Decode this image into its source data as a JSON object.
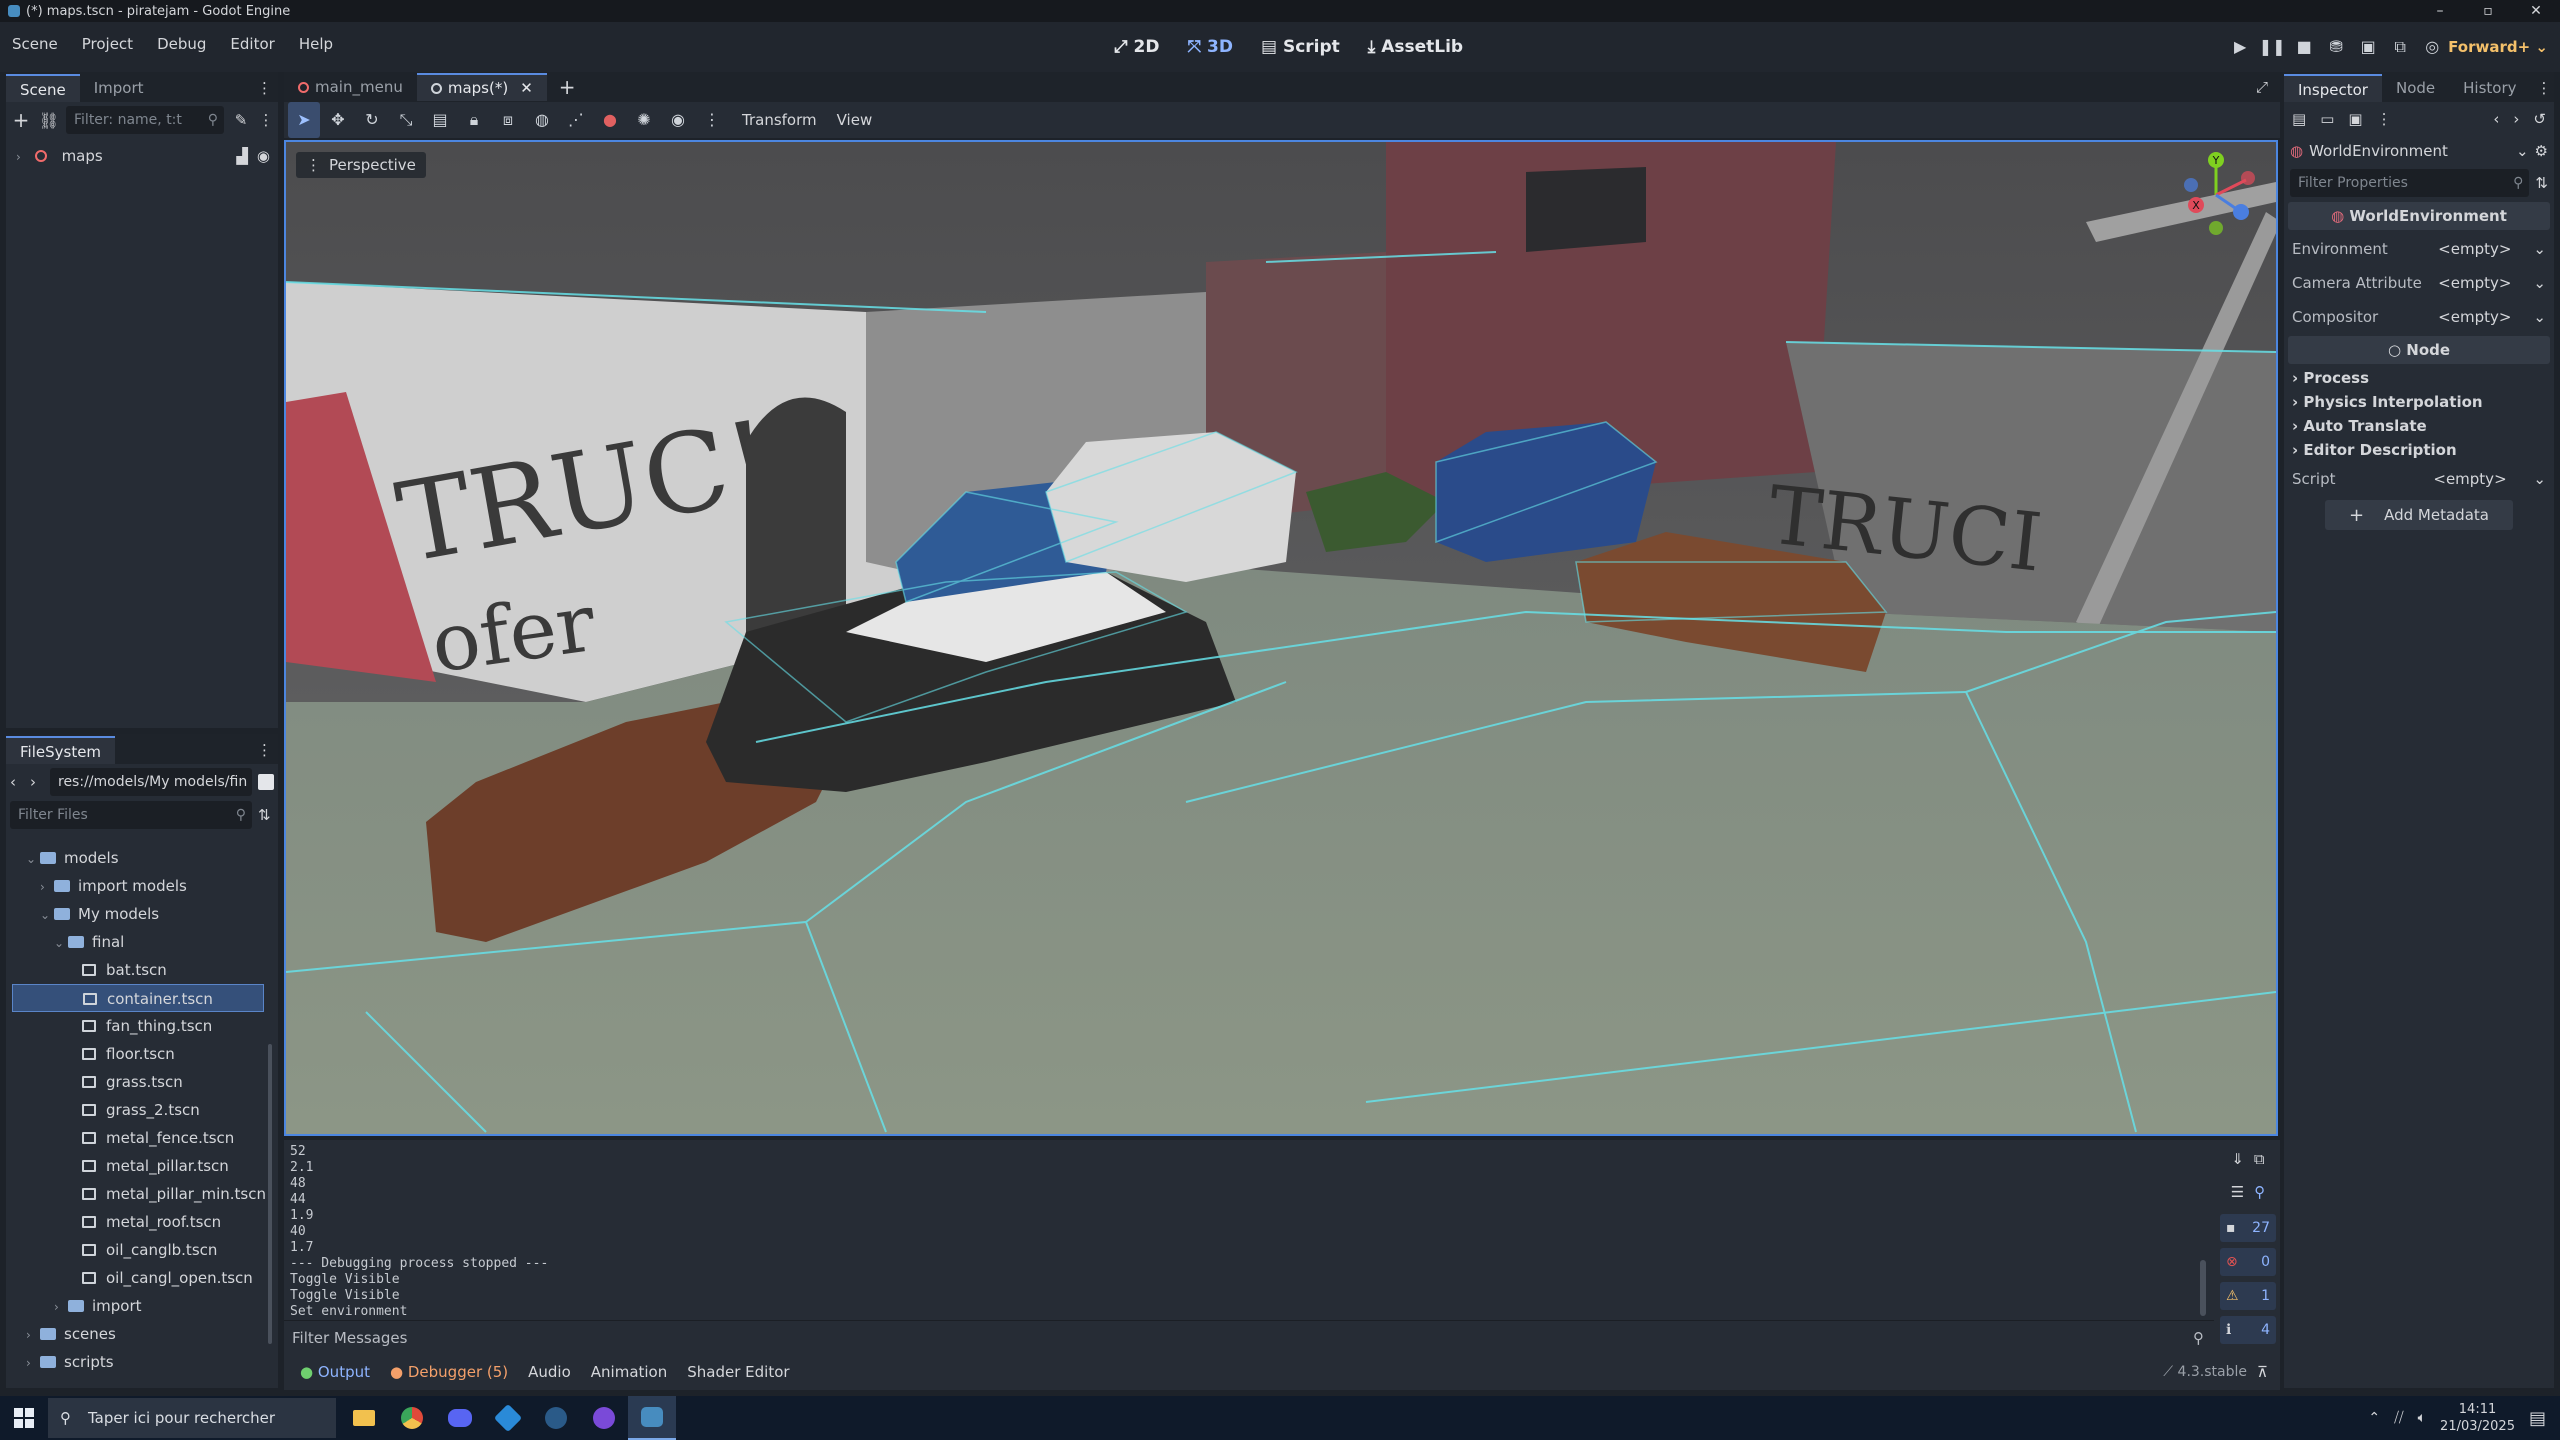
{
  "window": {
    "title": "(*) maps.tscn - piratejam - Godot Engine",
    "controls": [
      "–",
      "▫",
      "✕"
    ]
  },
  "menu": [
    "Scene",
    "Project",
    "Debug",
    "Editor",
    "Help"
  ],
  "modes": {
    "2d": "2D",
    "3d": "3D",
    "script": "Script",
    "assetlib": "AssetLib"
  },
  "renderer": "Forward+",
  "scene_dock": {
    "tabs": [
      "Scene",
      "Import"
    ],
    "filter_placeholder": "Filter: name, t:t",
    "root_node": "maps"
  },
  "filesystem": {
    "tab": "FileSystem",
    "path": "res://models/My models/fin",
    "filter_placeholder": "Filter Files",
    "items": [
      {
        "label": "models",
        "type": "folder",
        "depth": 1,
        "expanded": true
      },
      {
        "label": "import models",
        "type": "folder",
        "depth": 2,
        "expanded": false
      },
      {
        "label": "My models",
        "type": "folder",
        "depth": 2,
        "expanded": true
      },
      {
        "label": "final",
        "type": "folder",
        "depth": 3,
        "expanded": true
      },
      {
        "label": "bat.tscn",
        "type": "scene",
        "depth": 4
      },
      {
        "label": "container.tscn",
        "type": "scene",
        "depth": 4,
        "selected": true
      },
      {
        "label": "fan_thing.tscn",
        "type": "scene",
        "depth": 4
      },
      {
        "label": "floor.tscn",
        "type": "scene",
        "depth": 4
      },
      {
        "label": "grass.tscn",
        "type": "scene",
        "depth": 4
      },
      {
        "label": "grass_2.tscn",
        "type": "scene",
        "depth": 4
      },
      {
        "label": "metal_fence.tscn",
        "type": "scene",
        "depth": 4
      },
      {
        "label": "metal_pillar.tscn",
        "type": "scene",
        "depth": 4
      },
      {
        "label": "metal_pillar_min.tscn",
        "type": "scene",
        "depth": 4
      },
      {
        "label": "metal_roof.tscn",
        "type": "scene",
        "depth": 4
      },
      {
        "label": "oil_canglb.tscn",
        "type": "scene",
        "depth": 4
      },
      {
        "label": "oil_cangl_open.tscn",
        "type": "scene",
        "depth": 4
      },
      {
        "label": "import",
        "type": "folder",
        "depth": 3,
        "expanded": false
      },
      {
        "label": "scenes",
        "type": "folder",
        "depth": 1,
        "expanded": false
      },
      {
        "label": "scripts",
        "type": "folder",
        "depth": 1,
        "expanded": false
      }
    ]
  },
  "editor_tabs": [
    {
      "label": "main_menu",
      "active": false
    },
    {
      "label": "maps(*)",
      "active": true
    }
  ],
  "viewport_toolbar": {
    "transform": "Transform",
    "view": "View"
  },
  "viewport": {
    "perspective_label": "Perspective"
  },
  "output": {
    "log_lines": [
      "52",
      "2.1",
      "48",
      "44",
      "1.9",
      "40",
      "1.7",
      "--- Debugging process stopped ---",
      "Toggle Visible",
      "Toggle Visible",
      "Set environment"
    ],
    "filter_placeholder": "Filter Messages",
    "counts": {
      "messages": "27",
      "errors": "0",
      "warnings": "1",
      "info": "4"
    },
    "tabs": [
      "Output",
      "Debugger (5)",
      "Audio",
      "Animation",
      "Shader Editor"
    ],
    "version": "4.3.stable"
  },
  "inspector": {
    "tabs": [
      "Inspector",
      "Node",
      "History"
    ],
    "node_name": "WorldEnvironment",
    "filter_placeholder": "Filter Properties",
    "class_header": "WorldEnvironment",
    "properties": [
      {
        "label": "Environment",
        "value": "<empty>"
      },
      {
        "label": "Camera Attribute",
        "value": "<empty>"
      },
      {
        "label": "Compositor",
        "value": "<empty>"
      }
    ],
    "node_header": "Node",
    "groups": [
      "Process",
      "Physics Interpolation",
      "Auto Translate",
      "Editor Description"
    ],
    "script_label": "Script",
    "script_value": "<empty>",
    "add_metadata": "Add Metadata"
  },
  "taskbar": {
    "search_placeholder": "Taper ici pour rechercher",
    "time": "14:11",
    "date": "21/03/2025"
  },
  "colors": {
    "accent": "#4c86e0",
    "warning": "#f4c06a",
    "error": "#e05252",
    "wireframe": "#66e0e8"
  }
}
